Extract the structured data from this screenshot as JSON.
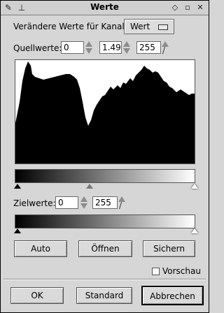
{
  "window": {
    "title": "Werte"
  },
  "channel": {
    "label": "Verändere Werte für Kanal:",
    "value": "Wert"
  },
  "input_levels": {
    "label": "Quellwerte:",
    "low": "0",
    "gamma": "1.49",
    "high": "255"
  },
  "output_levels": {
    "label": "Zielwerte:",
    "low": "0",
    "high": "255"
  },
  "buttons": {
    "auto": "Auto",
    "open": "Öffnen",
    "save": "Sichern",
    "ok": "OK",
    "standard": "Standard",
    "cancel": "Abbrechen"
  },
  "preview": {
    "label": "Vorschau",
    "checked": false
  },
  "icons": [
    "menu-icon",
    "pin-icon",
    "shade-icon",
    "maximize-icon",
    "close-icon"
  ]
}
